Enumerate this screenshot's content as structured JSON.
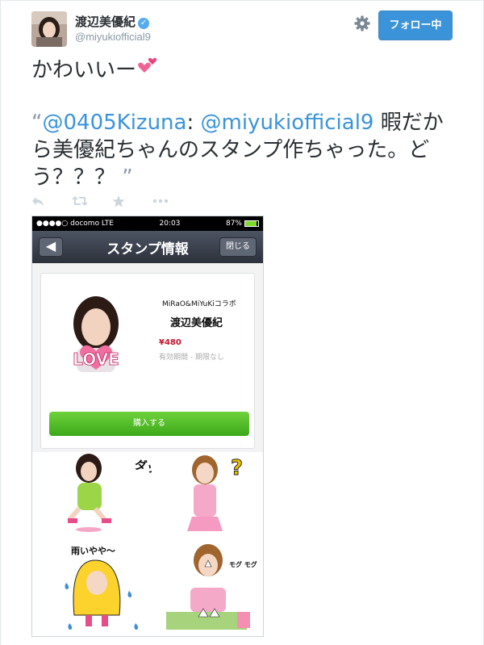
{
  "user": {
    "display_name": "渡辺美優紀",
    "handle": "@miyukiofficial9",
    "verified_icon": "verified-badge-icon"
  },
  "header": {
    "follow_label": "フォロー中",
    "settings_icon": "gear-icon"
  },
  "tweet": {
    "line1": "かわいいー",
    "line1_emoji": "two-hearts-icon",
    "quote_open": "“",
    "mention1": "@0405Kizuna",
    "colon": ": ",
    "mention2": "@miyukiofficial9",
    "body": " 暇だから美優紀ちゃんのスタンプ作ちゃった。どう？？？",
    "quote_close": " ”"
  },
  "actions": [
    "reply-icon",
    "retweet-icon",
    "favorite-icon",
    "more-icon"
  ],
  "media": {
    "status": {
      "carrier": "●●●●○ docomo  LTE",
      "time": "20:03",
      "battery": "87%",
      "battery_level": 0.87
    },
    "nav": {
      "back_label": "◀",
      "title": "スタンプ情報",
      "close_label": "閉じる"
    },
    "product": {
      "collab_title": "MiRaO&MiYuKiコラボ",
      "name": "渡辺美優紀",
      "price": "¥480",
      "expiry": "有効期間 - 期限なし",
      "buy_label": "購入する",
      "sticker_text": "LOVE"
    },
    "stickers": [
      {
        "caption": "ダッシュ!!"
      },
      {
        "caption": "?"
      },
      {
        "caption": "雨いやや〜"
      },
      {
        "caption": "モグ モグ モグ"
      }
    ]
  },
  "colors": {
    "link": "#3b94d9",
    "follow_button": "#3b94d9",
    "buy_button": "#4cbb26",
    "price": "#c8102e"
  }
}
